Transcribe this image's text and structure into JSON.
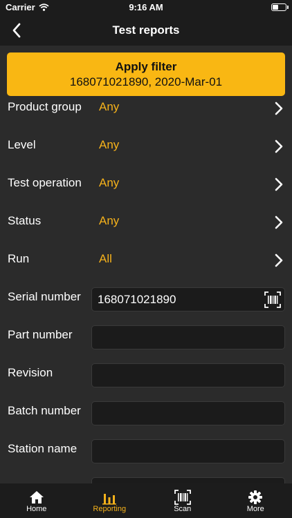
{
  "status_bar": {
    "carrier": "Carrier",
    "time": "9:16 AM"
  },
  "nav": {
    "title": "Test reports"
  },
  "apply_button": {
    "title": "Apply filter",
    "subtitle": "168071021890, 2020-Mar-01"
  },
  "filters": [
    {
      "label": "Product group",
      "value": "Any"
    },
    {
      "label": "Level",
      "value": "Any"
    },
    {
      "label": "Test operation",
      "value": "Any"
    },
    {
      "label": "Status",
      "value": "Any"
    },
    {
      "label": "Run",
      "value": "All"
    }
  ],
  "fields": [
    {
      "label": "Serial number",
      "value": "168071021890"
    },
    {
      "label": "Part number",
      "value": ""
    },
    {
      "label": "Revision",
      "value": ""
    },
    {
      "label": "Batch number",
      "value": ""
    },
    {
      "label": "Station name",
      "value": ""
    }
  ],
  "tabs": [
    {
      "label": "Home",
      "icon": "home-icon"
    },
    {
      "label": "Reporting",
      "icon": "bar-chart-icon"
    },
    {
      "label": "Scan",
      "icon": "barcode-scan-icon"
    },
    {
      "label": "More",
      "icon": "gear-icon"
    }
  ],
  "colors": {
    "accent": "#f9b713",
    "accent_text": "#f6b21b",
    "background": "#2b2b2b",
    "bar": "#1c1c1c"
  }
}
